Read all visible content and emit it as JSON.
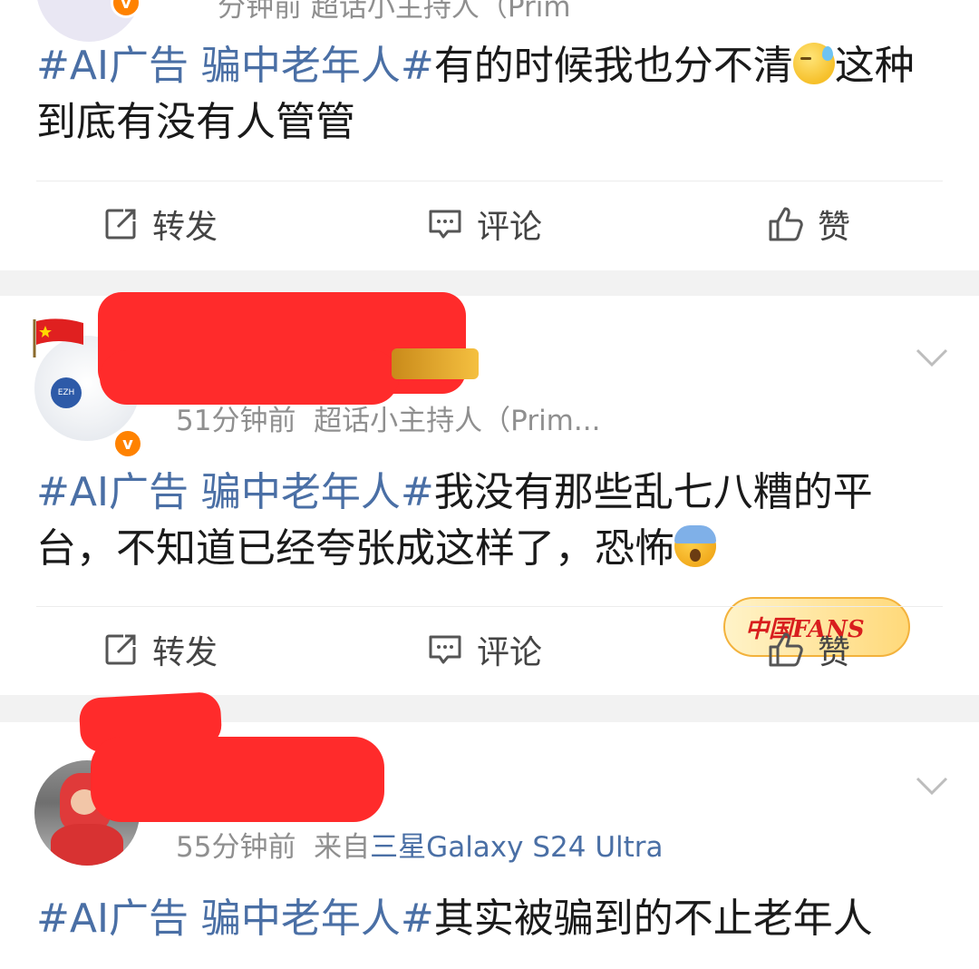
{
  "posts": [
    {
      "meta_partial": "分钟前 超话小主持人（Prim",
      "text_hashtag": "#AI广告 骗中老年人#",
      "text_main": "有的时候我也分不清",
      "text_after_emoji": "这种到底有没有人管管",
      "emoji": "sweat-smile-emoji"
    },
    {
      "time": "51分钟前",
      "source": "超话小主持人（Prim...",
      "badge_text": "中国FANS",
      "text_hashtag": "#AI广告 骗中老年人#",
      "text_main": "我没有那些乱七八糟的平台，不知道已经夸张成这样了，恐怖",
      "emoji": "screaming-fear-emoji"
    },
    {
      "time": "55分钟前",
      "source_prefix": "来自",
      "device": "三星Galaxy S24 Ultra",
      "text_hashtag": "#AI广告 骗中老年人#",
      "text_main": "其实被骗到的不止老年人"
    }
  ],
  "actions": {
    "repost": "转发",
    "comment": "评论",
    "like": "赞"
  },
  "colors": {
    "hashtag": "#4a6fa5",
    "redaction": "#ff2b2b",
    "vip_badge": "#ff8200",
    "separator": "#f2f2f2"
  }
}
